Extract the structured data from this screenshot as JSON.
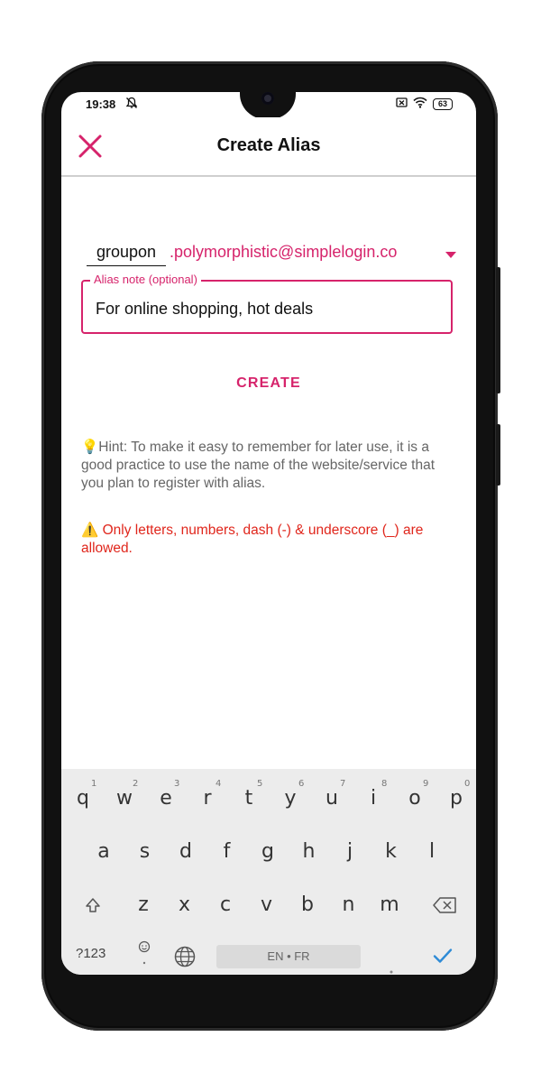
{
  "status_bar": {
    "time": "19:38",
    "icons": [
      "bell-off-icon",
      "sim-off-icon",
      "wifi-icon"
    ],
    "battery": "63"
  },
  "app_bar": {
    "title": "Create Alias",
    "close_icon": "close-icon"
  },
  "form": {
    "prefix_value": "groupon",
    "suffix": ".polymorphistic@simplelogin.co",
    "note_label": "Alias note (optional)",
    "note_value": "For online shopping, hot deals",
    "create_label": "CREATE"
  },
  "hint": "💡Hint: To make it easy to remember for later use, it is a good practice to use the name of the website/service that you plan to register with alias.",
  "warning": "⚠️ Only letters, numbers, dash (-) & underscore (_) are allowed.",
  "keyboard": {
    "row1": [
      {
        "k": "q",
        "n": "1"
      },
      {
        "k": "w",
        "n": "2"
      },
      {
        "k": "e",
        "n": "3"
      },
      {
        "k": "r",
        "n": "4"
      },
      {
        "k": "t",
        "n": "5"
      },
      {
        "k": "y",
        "n": "6"
      },
      {
        "k": "u",
        "n": "7"
      },
      {
        "k": "i",
        "n": "8"
      },
      {
        "k": "o",
        "n": "9"
      },
      {
        "k": "p",
        "n": "0"
      }
    ],
    "row2": [
      "a",
      "s",
      "d",
      "f",
      "g",
      "h",
      "j",
      "k",
      "l"
    ],
    "row3": [
      "z",
      "x",
      "c",
      "v",
      "b",
      "n",
      "m"
    ],
    "symbols_label": "?123",
    "space_label": "EN • FR",
    "bottom_icons": [
      "emoji-icon",
      "globe-icon",
      "shift-icon",
      "backspace-icon",
      "checkmark-icon"
    ]
  },
  "colors": {
    "accent": "#d6236b",
    "warning": "#e0261c",
    "hint": "#666666",
    "keyboard_bg": "#ececec"
  }
}
